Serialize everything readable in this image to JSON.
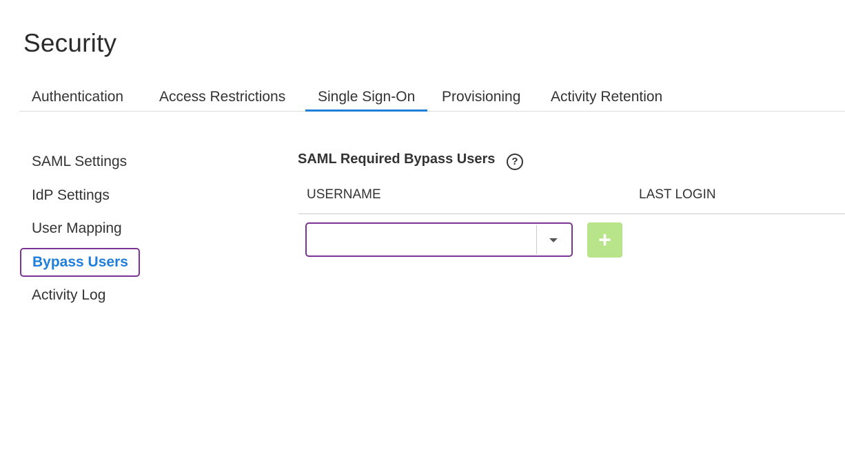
{
  "page": {
    "title": "Security"
  },
  "tabs": [
    {
      "label": "Authentication"
    },
    {
      "label": "Access Restrictions"
    },
    {
      "label": "Single Sign-On",
      "active": true
    },
    {
      "label": "Provisioning"
    },
    {
      "label": "Activity Retention"
    }
  ],
  "sidenav": {
    "items": [
      {
        "label": "SAML Settings"
      },
      {
        "label": "IdP Settings"
      },
      {
        "label": "User Mapping"
      },
      {
        "label": "Bypass Users",
        "active": true
      },
      {
        "label": "Activity Log"
      }
    ]
  },
  "main": {
    "section_title": "SAML Required Bypass Users",
    "help_icon": "question-circle-icon",
    "help_glyph": "?",
    "columns": {
      "username": "USERNAME",
      "last_login": "LAST LOGIN"
    },
    "user_select": {
      "value": "",
      "icon": "caret-down-icon"
    },
    "add_button": {
      "label": "+",
      "icon": "plus-icon",
      "color": "#b8e48a",
      "enabled": false
    }
  },
  "colors": {
    "accent": "#1f7ed9",
    "focus_outline": "#7b3396",
    "add_button_disabled": "#b8e48a"
  }
}
